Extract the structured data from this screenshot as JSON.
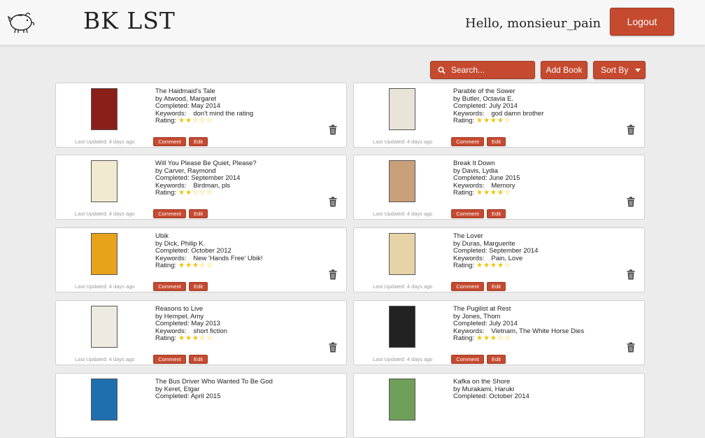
{
  "header": {
    "app_title": "BK LST",
    "greeting": "Hello, monsieur_pain",
    "logout_label": "Logout",
    "logo_icon": "piggy-bank-icon"
  },
  "toolbar": {
    "search_label": "Search...",
    "add_book_label": "Add Book",
    "sort_by_label": "Sort By"
  },
  "colors": {
    "accent": "#c54a30",
    "star": "#f2c200",
    "background": "#ececec"
  },
  "labels": {
    "comment": "Comment",
    "edit": "Edit"
  },
  "books": [
    {
      "title": "The Haidmaid's Tale",
      "author": "by Atwood, Margaret",
      "completed": "Completed: May 2014",
      "keywords_label": "Keywords:",
      "keywords": "don't mind the rating",
      "rating_label": "Rating:",
      "rating": 2,
      "stars": "★★☆☆☆",
      "updated": "Last Updated: 4 days ago",
      "cover_color": "#8a1f1a"
    },
    {
      "title": "Parable of the Sower",
      "author": "by Butler, Octavia E.",
      "completed": "Completed: July 2014",
      "keywords_label": "Keywords:",
      "keywords": "god damn brother",
      "rating_label": "Rating:",
      "rating": 4,
      "stars": "★★★★☆",
      "updated": "Last Updated: 4 days ago",
      "cover_color": "#e9e4d8"
    },
    {
      "title": "Will You Please Be Quiet, Please?",
      "author": "by Carver, Raymond",
      "completed": "Completed: September 2014",
      "keywords_label": "Keywords:",
      "keywords": "Birdman, pls",
      "rating_label": "Rating:",
      "rating": 2,
      "stars": "★★☆☆☆",
      "updated": "Last Updated: 4 days ago",
      "cover_color": "#f1ead0"
    },
    {
      "title": "Break It Down",
      "author": "by Davis, Lydia",
      "completed": "Completed: June 2015",
      "keywords_label": "Keywords:",
      "keywords": "Memory",
      "rating_label": "Rating:",
      "rating": 4,
      "stars": "★★★★☆",
      "updated": "Last Updated: 4 days ago",
      "cover_color": "#c9a07a"
    },
    {
      "title": "Ubik",
      "author": "by Dick, Philip K.",
      "completed": "Completed: October 2012",
      "keywords_label": "Keywords:",
      "keywords": "New 'Hands Free' Ubik!",
      "rating_label": "Rating:",
      "rating": 3,
      "stars": "★★★☆☆",
      "updated": "Last Updated: 4 days ago",
      "cover_color": "#e8a21c"
    },
    {
      "title": "The Lover",
      "author": "by Duras, Marguerite",
      "completed": "Completed: September 2014",
      "keywords_label": "Keywords:",
      "keywords": "Pain, Love",
      "rating_label": "Rating:",
      "rating": 4,
      "stars": "★★★★☆",
      "updated": "Last Updated: 4 days ago",
      "cover_color": "#e6d3a8"
    },
    {
      "title": "Reasons to Live",
      "author": "by Hempel, Amy",
      "completed": "Completed: May 2013",
      "keywords_label": "Keywords:",
      "keywords": "short fiction",
      "rating_label": "Rating:",
      "rating": 3,
      "stars": "★★★☆☆",
      "updated": "Last Updated: 4 days ago",
      "cover_color": "#efeadf"
    },
    {
      "title": "The Pugilist at Rest",
      "author": "by Jones, Thom",
      "completed": "Completed: July 2014",
      "keywords_label": "Keywords:",
      "keywords": "Vietnam, The White Horse Dies",
      "rating_label": "Rating:",
      "rating": 3,
      "stars": "★★★☆☆",
      "updated": "Last Updated: 4 days ago",
      "cover_color": "#222222"
    },
    {
      "title": "The Bus Driver Who Wanted To Be God",
      "author": "by Keret, Etgar",
      "completed": "Completed: April 2015",
      "keywords_label": "",
      "keywords": "",
      "rating_label": "",
      "rating": 0,
      "stars": "",
      "updated": "",
      "cover_color": "#1f6fb0"
    },
    {
      "title": "Kafka on the Shore",
      "author": "by Murakami, Haruki",
      "completed": "Completed: October 2014",
      "keywords_label": "",
      "keywords": "",
      "rating_label": "",
      "rating": 0,
      "stars": "",
      "updated": "",
      "cover_color": "#6fa05a"
    }
  ]
}
